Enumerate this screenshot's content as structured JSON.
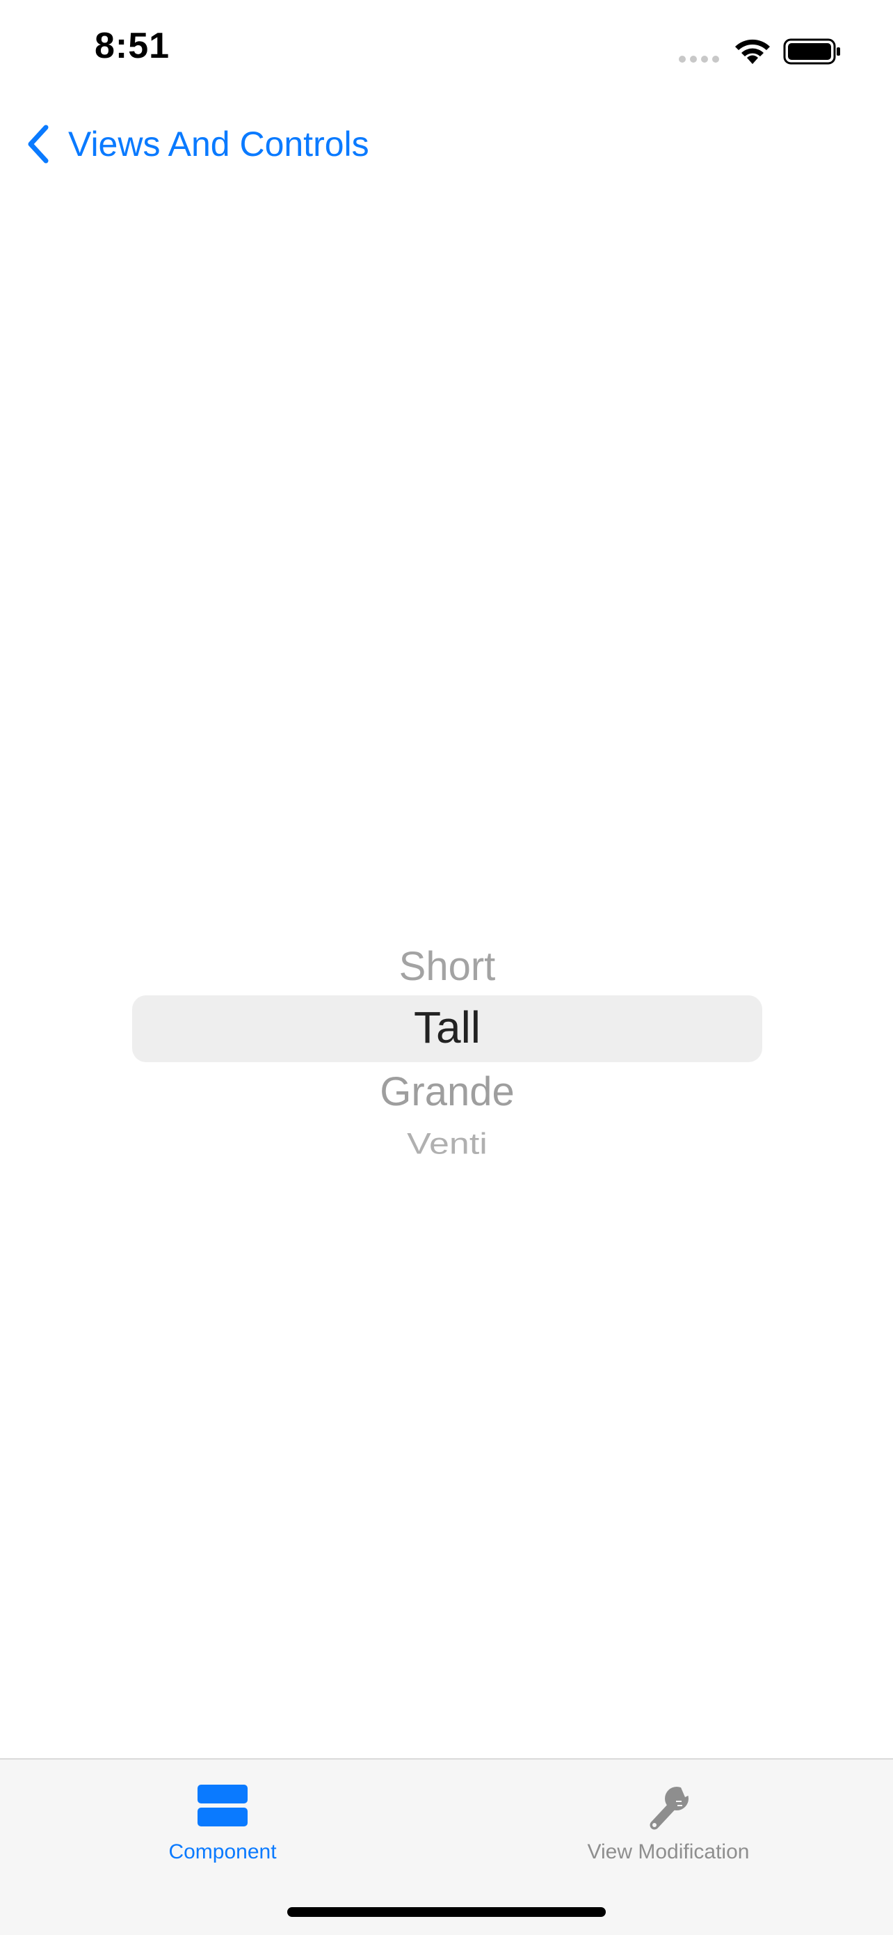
{
  "status_bar": {
    "time": "8:51",
    "icons": [
      "signal-dots-icon",
      "wifi-icon",
      "battery-icon"
    ]
  },
  "nav": {
    "back_label": "Views And Controls",
    "accent_color": "#0a7aff"
  },
  "picker": {
    "items": [
      "Short",
      "Tall",
      "Grande",
      "Venti"
    ],
    "selected": "Tall"
  },
  "tab_bar": {
    "tabs": [
      {
        "label": "Component",
        "icon": "stacked-rectangles-icon",
        "selected": true
      },
      {
        "label": "View Modification",
        "icon": "wrench-icon",
        "selected": false
      }
    ]
  }
}
